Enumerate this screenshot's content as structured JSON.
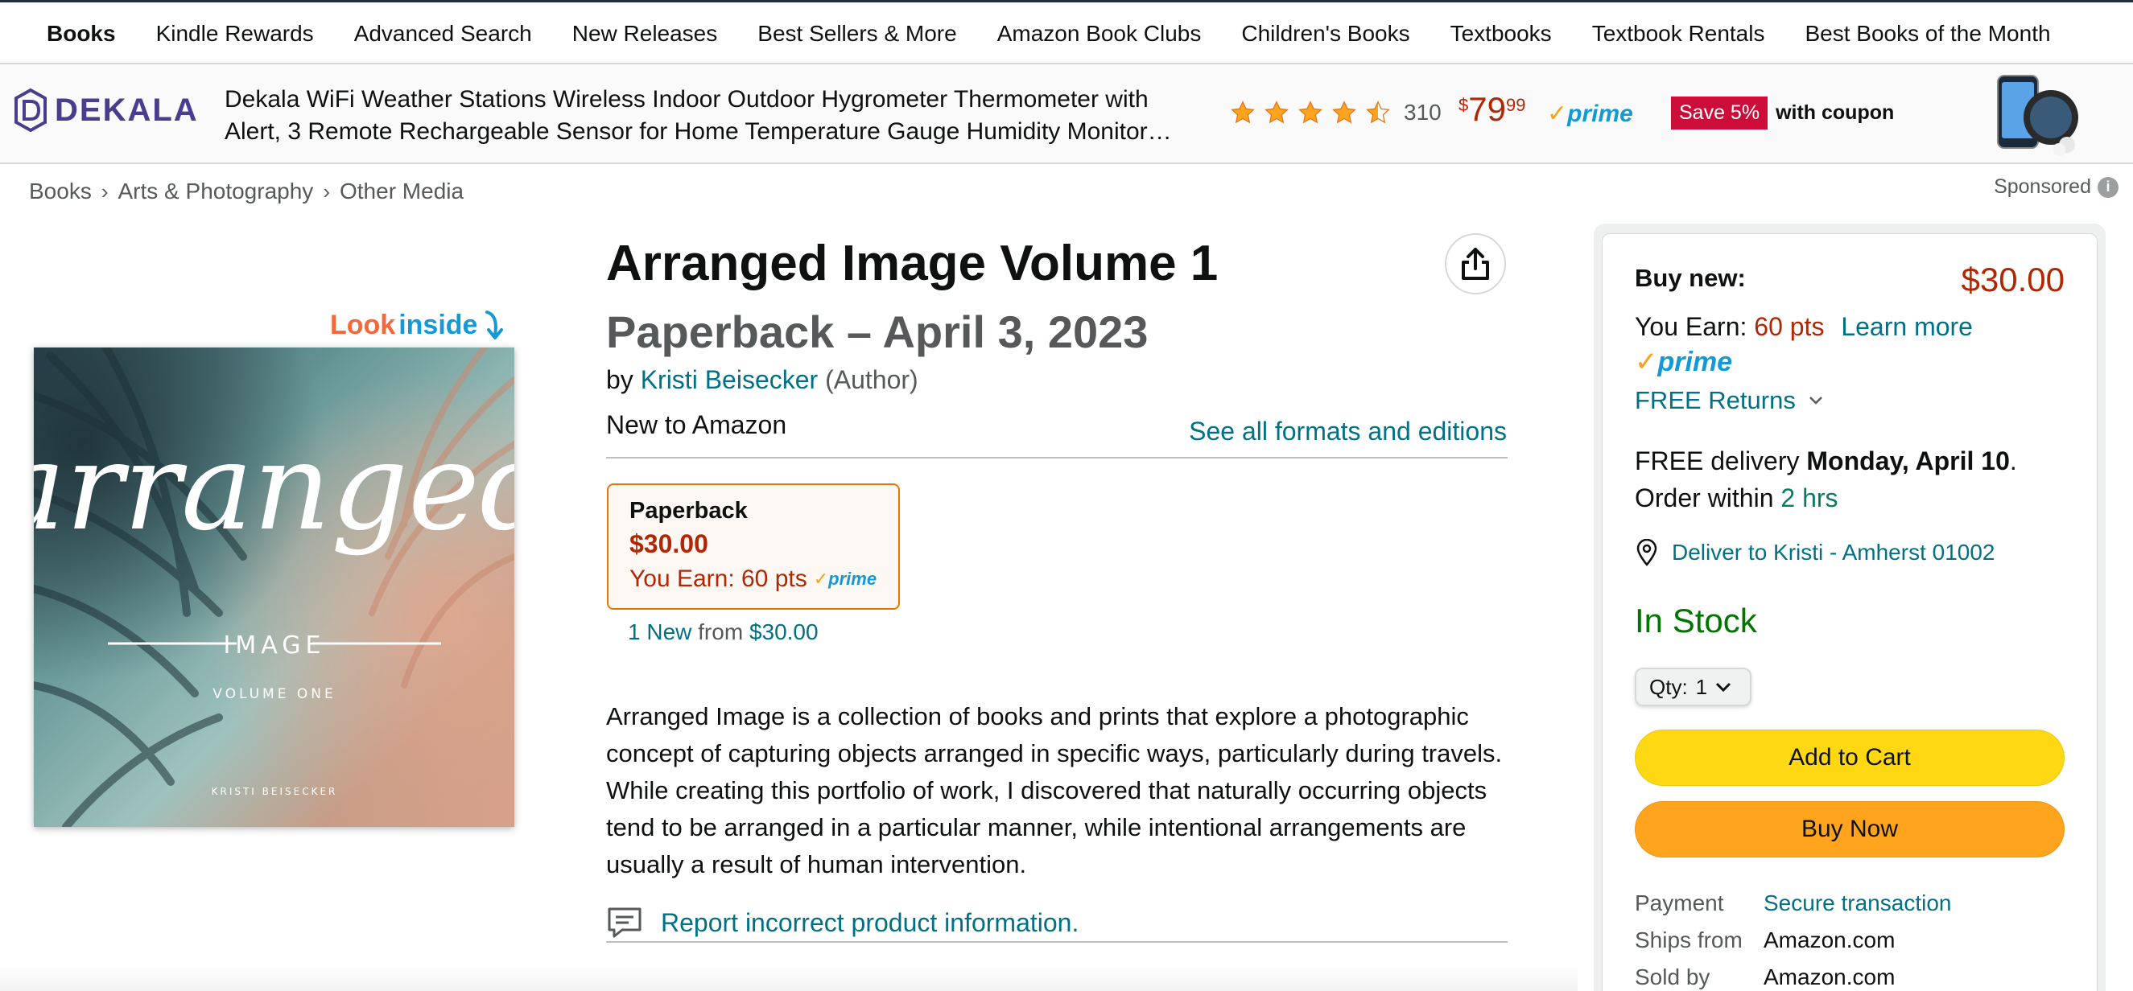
{
  "subnav": {
    "items": [
      "Books",
      "Kindle Rewards",
      "Advanced Search",
      "New Releases",
      "Best Sellers & More",
      "Amazon Book Clubs",
      "Children's Books",
      "Textbooks",
      "Textbook Rentals",
      "Best Books of the Month"
    ]
  },
  "ad": {
    "brand": "DEKALA",
    "title_line1": "Dekala WiFi Weather Stations Wireless Indoor Outdoor Hygrometer Thermometer with",
    "title_line2": "Alert, 3 Remote Rechargeable Sensor for Home Temperature Gauge Humidity Monitor…",
    "rating_stars": 4.5,
    "rating_count": "310",
    "price_symbol": "$",
    "price_whole": "79",
    "price_fraction": "99",
    "prime": "prime",
    "save_label": "Save 5%",
    "coupon_label": "with coupon"
  },
  "breadcrumb": [
    "Books",
    "Arts & Photography",
    "Other Media"
  ],
  "sponsored": {
    "label": "Sponsored",
    "info_glyph": "i"
  },
  "image": {
    "look_label": "Look",
    "inside_label": "inside",
    "cover_script": "arranged",
    "cover_subtitle": "IMAGE",
    "cover_volume": "VOLUME ONE",
    "cover_author": "KRISTI BEISECKER"
  },
  "product": {
    "title": "Arranged Image Volume 1",
    "format_and_date": "Paperback – April 3, 2023",
    "by": "by",
    "author": "Kristi Beisecker",
    "role": "(Author)",
    "new_to": "New to Amazon",
    "see_formats": "See all formats and editions",
    "format_card": {
      "name": "Paperback",
      "price": "$30.00",
      "earn": "You Earn: 60 pts"
    },
    "new_from": {
      "count": "1 New",
      "from": "from",
      "price": "$30.00"
    },
    "description": "Arranged Image is a collection of books and prints that explore a photographic concept of capturing objects arranged in specific ways, particularly during travels. While creating this portfolio of work, I discovered that naturally occurring objects tend to be arranged in a particular manner, while intentional arrangements are usually a result of human intervention.",
    "report": "Report incorrect product information."
  },
  "buybox": {
    "buy_new": "Buy new:",
    "price": "$30.00",
    "earn_label": "You Earn:",
    "earn_pts": "60 pts",
    "learn_more": "Learn more",
    "prime": "prime",
    "free_returns": "FREE Returns",
    "delivery_prefix": "FREE delivery",
    "delivery_date": "Monday, April 10",
    "delivery_suffix": ".",
    "order_within": "Order within",
    "order_time": "2 hrs",
    "deliver_to": "Deliver to Kristi - Amherst 01002",
    "stock": "In Stock",
    "qty_label": "Qty:",
    "qty_value": "1",
    "add_to_cart": "Add to Cart",
    "buy_now": "Buy Now",
    "details": [
      {
        "k": "Payment",
        "v": "Secure transaction"
      },
      {
        "k": "Ships from",
        "v": "Amazon.com"
      },
      {
        "k": "Sold by",
        "v": "Amazon.com"
      }
    ]
  },
  "colors": {
    "link": "#007185",
    "price": "#b12704",
    "in_stock": "#007600",
    "cart_button": "#ffd814",
    "buy_button": "#ffa41c",
    "prime_blue": "#1399d3",
    "save_red": "#cc0c39"
  }
}
